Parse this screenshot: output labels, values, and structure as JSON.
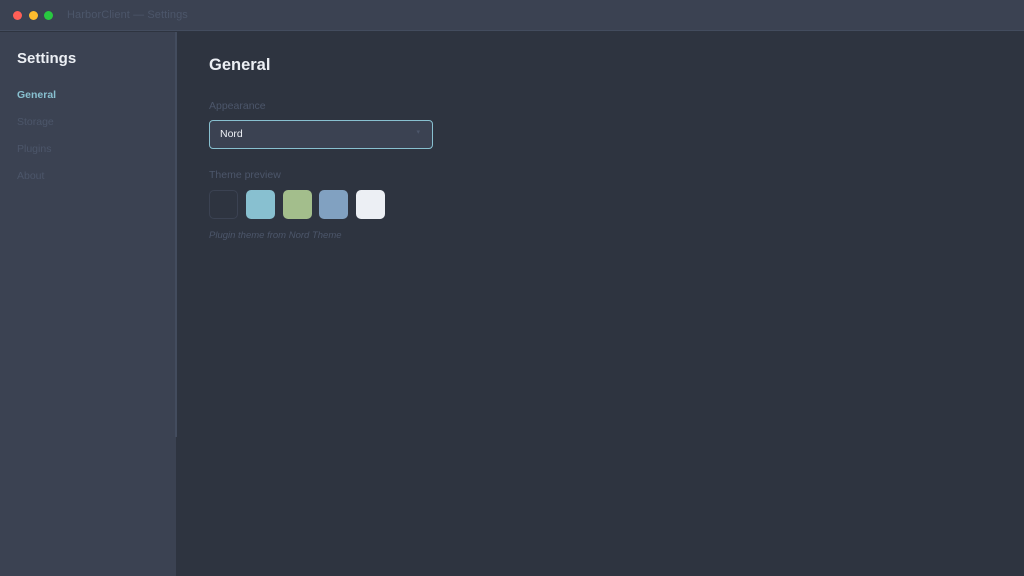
{
  "window": {
    "title": "HarborClient — Settings"
  },
  "sidebar": {
    "heading": "Settings",
    "items": [
      {
        "label": "General",
        "active": true
      },
      {
        "label": "Storage",
        "active": false
      },
      {
        "label": "Plugins",
        "active": false
      },
      {
        "label": "About",
        "active": false
      }
    ]
  },
  "main": {
    "title": "General",
    "appearance": {
      "label": "Appearance",
      "selected": "Nord",
      "chevron": "▾"
    },
    "preview": {
      "label": "Theme preview",
      "swatches": [
        "#2e3440",
        "#88c0d0",
        "#a3be8c",
        "#81a1c1",
        "#eceff4"
      ],
      "hint": "Plugin theme from Nord Theme"
    }
  },
  "colors": {
    "background": "#2e3440",
    "sidebar": "#3b4252",
    "accent": "#88c0d0",
    "text": "#eceff4",
    "muted": "#4c566a"
  }
}
